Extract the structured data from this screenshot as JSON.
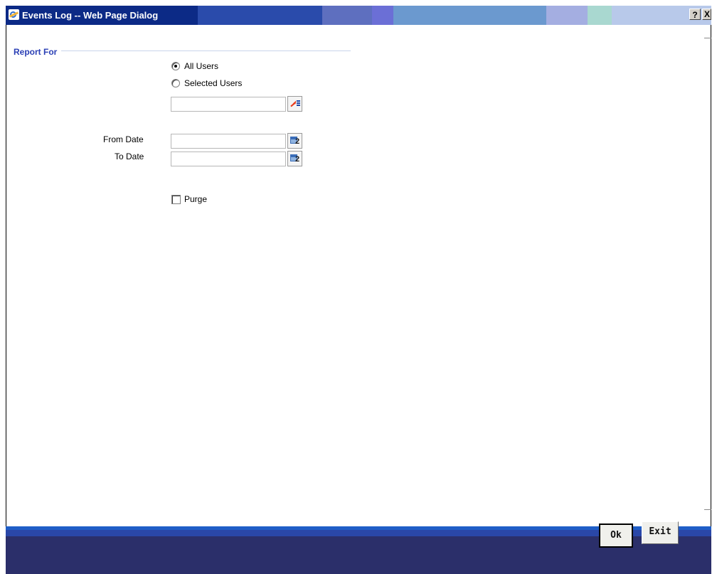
{
  "window": {
    "title": "Events Log -- Web Page Dialog",
    "help_label": "?",
    "close_label": "X"
  },
  "report_for": {
    "legend": "Report For",
    "options": [
      {
        "label": "All Users",
        "selected": true
      },
      {
        "label": "Selected Users",
        "selected": false
      }
    ],
    "user_value": ""
  },
  "dates": {
    "from_label": "From Date",
    "from_value": "",
    "to_label": "To Date",
    "to_value": ""
  },
  "purge": {
    "label": "Purge",
    "checked": false
  },
  "footer": {
    "ok_label": "Ok",
    "exit_label": "Exit"
  },
  "icons": {
    "lov": "list-of-values-icon",
    "calendar": "calendar-icon"
  },
  "colors": {
    "titlebar": "#0c2a86",
    "legend": "#2a3fb5",
    "footer": "#2b2f6a",
    "footer_strip": "#1f5ec7"
  }
}
